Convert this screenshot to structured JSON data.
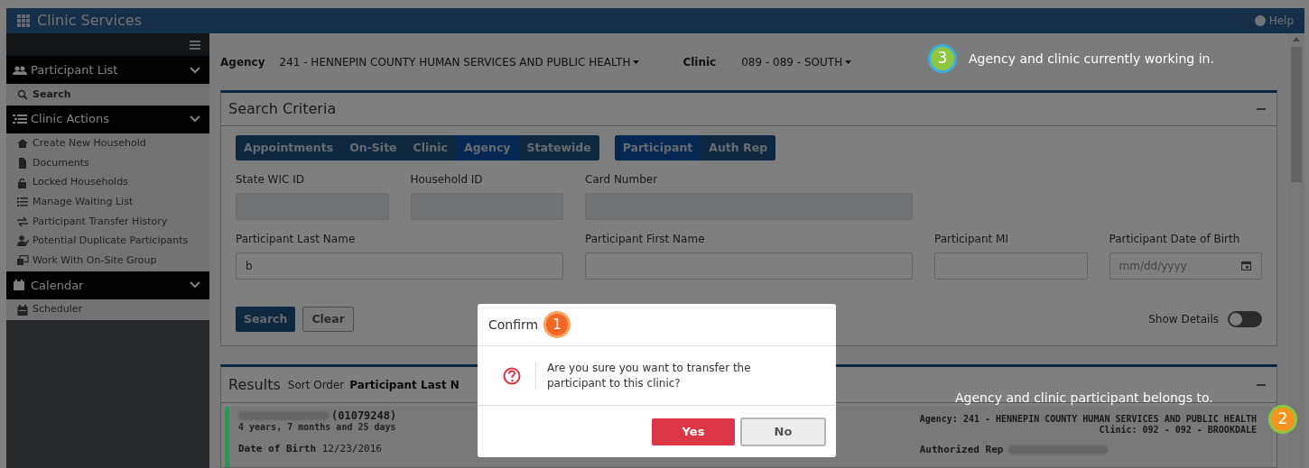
{
  "app_bar": {
    "title": "Clinic Services",
    "help": "Help"
  },
  "sidebar": {
    "sections": [
      {
        "label": "Participant List",
        "expanded": true,
        "items": [
          {
            "label": "Search",
            "selected": true
          }
        ]
      },
      {
        "label": "Clinic Actions",
        "expanded": true,
        "items": [
          {
            "label": "Create New Household",
            "selected": false
          },
          {
            "label": "Documents",
            "selected": false
          },
          {
            "label": "Locked Households",
            "selected": false
          },
          {
            "label": "Manage Waiting List",
            "selected": false
          },
          {
            "label": "Participant Transfer History",
            "selected": false
          },
          {
            "label": "Potential Duplicate Participants",
            "selected": false
          },
          {
            "label": "Work With On-Site Group",
            "selected": false
          }
        ]
      },
      {
        "label": "Calendar",
        "expanded": true,
        "items": [
          {
            "label": "Scheduler",
            "selected": false
          }
        ]
      }
    ]
  },
  "context": {
    "agency_label": "Agency",
    "agency": "241 - HENNEPIN COUNTY HUMAN SERVICES AND PUBLIC HEALTH",
    "clinic_label": "Clinic",
    "clinic": "089 - 089 - SOUTH"
  },
  "search_criteria": {
    "title": "Search Criteria",
    "scope_tabs": [
      {
        "label": "Appointments",
        "selected": false
      },
      {
        "label": "On-Site",
        "selected": false
      },
      {
        "label": "Clinic",
        "selected": false
      },
      {
        "label": "Agency",
        "selected": true
      },
      {
        "label": "Statewide",
        "selected": false
      }
    ],
    "mode_tabs": [
      {
        "label": "Participant",
        "selected": true
      },
      {
        "label": "Auth Rep",
        "selected": false
      }
    ],
    "field_rows": [
      [
        {
          "label": "State WIC ID",
          "disabled": true
        },
        {
          "label": "Household ID",
          "disabled": true
        },
        {
          "label": "Card Number",
          "disabled": true
        }
      ],
      [
        {
          "label": "Participant Last Name",
          "value": "b",
          "disabled": false
        },
        {
          "label": "Participant First Name",
          "disabled": false
        },
        {
          "label": "Participant MI",
          "disabled": false
        },
        {
          "label": "Participant Date of Birth",
          "placeholder": "mm/dd/yyyy",
          "kind": "date",
          "disabled": false
        }
      ]
    ],
    "buttons": [
      "Search",
      "Clear"
    ],
    "show_details": {
      "label": "Show Details",
      "on": false
    }
  },
  "results": {
    "title": "Results",
    "sort_label": "Sort Order",
    "sort_value": "Participant Last N",
    "row": {
      "color": "#1f9d55",
      "id": "(01079248)",
      "age": "4 years, 7 months and 25 days",
      "dob_label": "Date of Birth",
      "dob": "12/23/2016",
      "agency": "Agency: 241 - HENNEPIN COUNTY HUMAN SERVICES AND PUBLIC HEALTH",
      "clinic": "Clinic: 092 - 092 - BROOKDALE",
      "auth_rep_label": "Authorized Rep"
    }
  },
  "dialog": {
    "title": "Confirm",
    "badge": {
      "number": "1",
      "color": "#f26522"
    },
    "message": "Are you sure you want to transfer the participant to this clinic?",
    "buttons": [
      "Yes",
      "No"
    ]
  },
  "annotations": [
    {
      "number": "3",
      "text": "Agency and clinic currently working in.",
      "color": "#8dc63f"
    },
    {
      "number": "2",
      "text": "Agency and clinic participant belongs to.",
      "color": "#f7941d"
    }
  ]
}
